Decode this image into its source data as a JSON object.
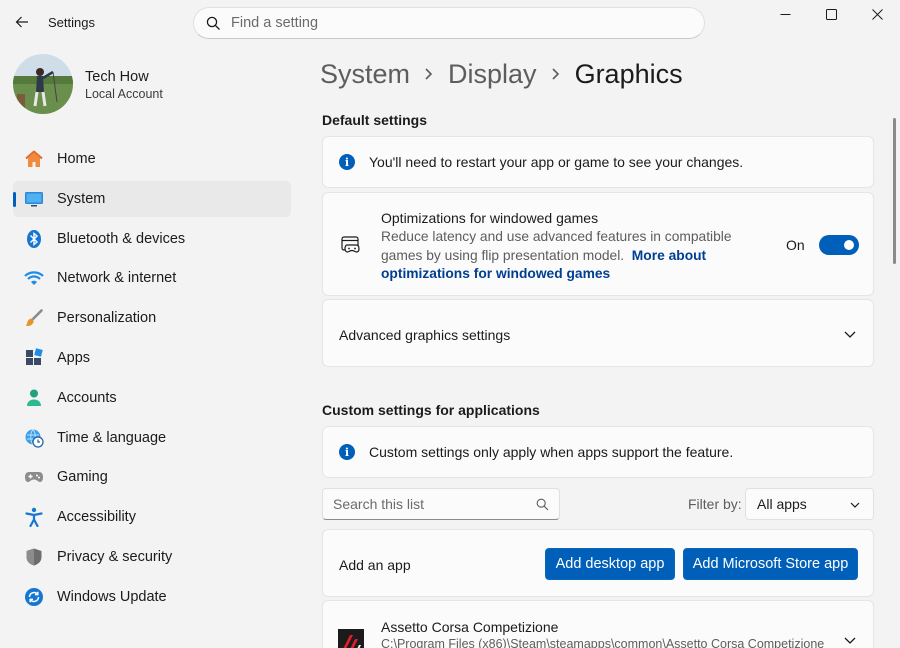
{
  "window": {
    "title": "Settings"
  },
  "search": {
    "placeholder": "Find a setting"
  },
  "user": {
    "name": "Tech How",
    "account_type": "Local Account"
  },
  "nav": [
    {
      "label": "Home",
      "icon": "home-icon"
    },
    {
      "label": "System",
      "icon": "system-icon",
      "active": true
    },
    {
      "label": "Bluetooth & devices",
      "icon": "bluetooth-icon"
    },
    {
      "label": "Network & internet",
      "icon": "wifi-icon"
    },
    {
      "label": "Personalization",
      "icon": "brush-icon"
    },
    {
      "label": "Apps",
      "icon": "apps-icon"
    },
    {
      "label": "Accounts",
      "icon": "accounts-icon"
    },
    {
      "label": "Time & language",
      "icon": "globe-clock-icon"
    },
    {
      "label": "Gaming",
      "icon": "gamepad-icon"
    },
    {
      "label": "Accessibility",
      "icon": "accessibility-icon"
    },
    {
      "label": "Privacy & security",
      "icon": "shield-icon"
    },
    {
      "label": "Windows Update",
      "icon": "update-icon"
    }
  ],
  "breadcrumb": [
    "System",
    "Display",
    "Graphics"
  ],
  "default_settings": {
    "title": "Default settings",
    "info": "You'll need to restart your app or game to see your changes.",
    "optimizations": {
      "title": "Optimizations for windowed games",
      "desc_line1": "Reduce latency and use advanced features in compatible",
      "desc_line2": "games by using flip presentation model.",
      "link_part1": "More about",
      "link_part2": "optimizations for windowed games",
      "toggle_label": "On",
      "toggle_on": true
    },
    "advanced": "Advanced graphics settings"
  },
  "custom_settings": {
    "title": "Custom settings for applications",
    "info": "Custom settings only apply when apps support the feature.",
    "search_placeholder": "Search this list",
    "filter_label": "Filter by:",
    "filter_value": "All apps",
    "add_app_label": "Add an app",
    "add_desktop_button": "Add desktop app",
    "add_store_button": "Add Microsoft Store app",
    "apps": [
      {
        "name": "Assetto Corsa Competizione",
        "path": "C:\\Program Files (x86)\\Steam\\steamapps\\common\\Assetto Corsa Competizione"
      }
    ]
  },
  "colors": {
    "accent": "#005fb8",
    "link": "#003e92",
    "background": "#f3f3f3",
    "card": "#fbfbfb"
  }
}
